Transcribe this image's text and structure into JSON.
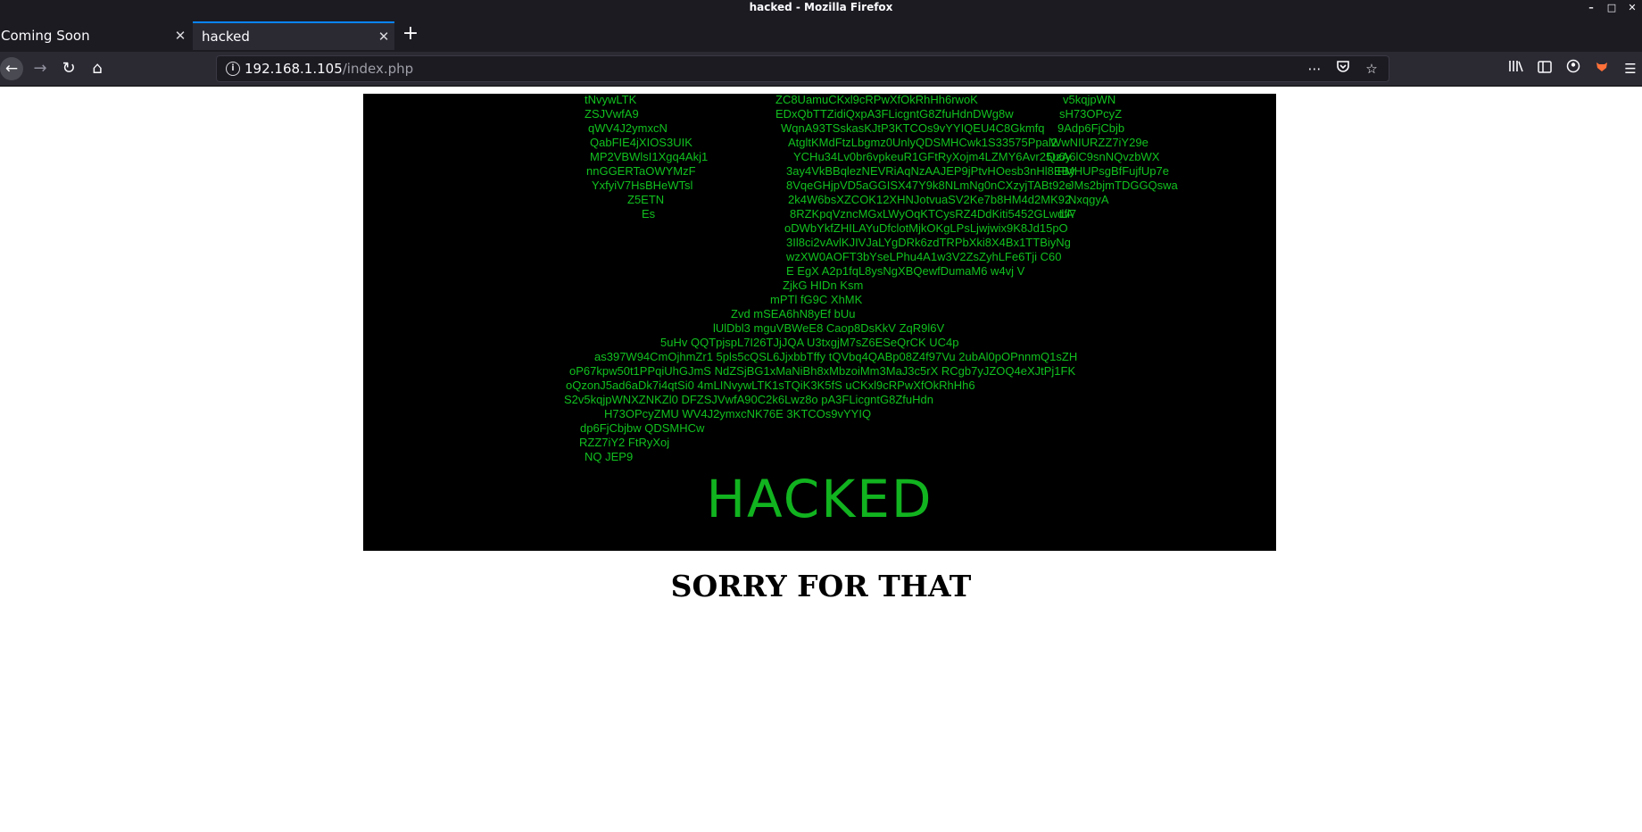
{
  "window": {
    "title": "hacked - Mozilla Firefox"
  },
  "tabs": [
    {
      "label": "Coming Soon",
      "active": false
    },
    {
      "label": "hacked",
      "active": true
    }
  ],
  "navbar": {
    "url_host": "192.168.1.105",
    "url_path": "/index.php"
  },
  "page": {
    "banner_word": "HACKED",
    "heading": "SORRY FOR THAT",
    "matrix_color": "#11c11f",
    "matrix_lines": [
      "tNvywLTK",
      "ZSJVwfA9",
      "qWV4J2ymxcN",
      "QabFIE4jXIOS3UIK",
      "MP2VBWlsI1Xgq4Akj1",
      "nnGGERTaOWYMzF",
      "YxfyiV7HsBHeWTsl",
      "Z5ETN",
      "Es",
      "ZC8UamuCKxl9cRPwXfOkRhHh6rwoK",
      "EDxQbTTZidiQxpA3FLicgntG8ZfuHdnDWg8w",
      "WqnA93TSskasKJtP3KTCOs9vYYIQEU4C8Gkmfq",
      "AtgltKMdFtzLbgmz0UnlyQDSMHCwk1S33575Ppal2",
      "YCHu34Lv0br6vpkeuR1GFtRyXojm4LZMY6Avr25u6y",
      "3ay4VkBBqlezNEVRiAqNzAAJEP9jPtvHOesb3nHl8EBy",
      "8VqeGHjpVD5aGGISX47Y9k8NLmNg0nCXzyjTABt92e",
      "2k4W6bsXZCOK12XHNJotvuaSV2Ke7b8HM4d2MK92",
      "8RZKpqVzncMGxLWyOqKTCysRZ4DdKiti5452GLwdfl7",
      "oDWbYkfZHILAYuDfclotMjkOKgLPsLjwjwix9K8Jd15pO",
      "3Il8ci2vAvlKJIVJaLYgDRk6zdTRPbXki8X4Bx1TTBiyNg",
      "wzXW0AOFT3bYseLPhu4A1w3V2ZsZyhLFe6Tji C60",
      "E EgX A2p1fqL8ysNgXBQewfDumaM6 w4vj V",
      "v5kqjpWN",
      "sH73OPcyZ",
      "9Adp6FjCbjb",
      "WwNIURZZ7iY29e",
      "QzA6lC9snNQvzbWX",
      "FMHUPsgBfFujfUp7e",
      "JMs2bjmTDGGQswa",
      "NxqgyA",
      "LA",
      "ZjkG HIDn Ksm",
      "mPTl fG9C XhMK",
      "Zvd mSEA6hN8yEf bUu",
      "lUlDbl3 mguVBWeE8 Caop8DsKkV ZqR9l6V",
      "5uHv QQTpjspL7I26TJjJQA U3txgjM7sZ6ESeQrCK UC4p",
      "as397W94CmOjhmZr1 5pls5cQSL6JjxbbTffy tQVbq4QABp08Z4f97Vu 2ubAl0pOPnnmQ1sZH",
      "oP67kpw50t1PPqiUhGJmS NdZSjBG1xMaNiBh8xMbzoiMm3MaJ3c5rX RCgb7yJZOQ4eXJtPj1FK",
      "oQzonJ5ad6aDk7i4qtSi0 4mLINvywLTK1sTQiK3K5fS uCKxl9cRPwXfOkRhHh6",
      "S2v5kqjpWNXZNKZl0 DFZSJVwfA90C2k6Lwz8o pA3FLicgntG8ZfuHdn",
      "H73OPcyZMU WV4J2ymxcNK76E 3KTCOs9vYYIQ",
      "dp6FjCbjbw QDSMHCw",
      "RZZ7iY2 FtRyXoj",
      "NQ JEP9"
    ]
  }
}
